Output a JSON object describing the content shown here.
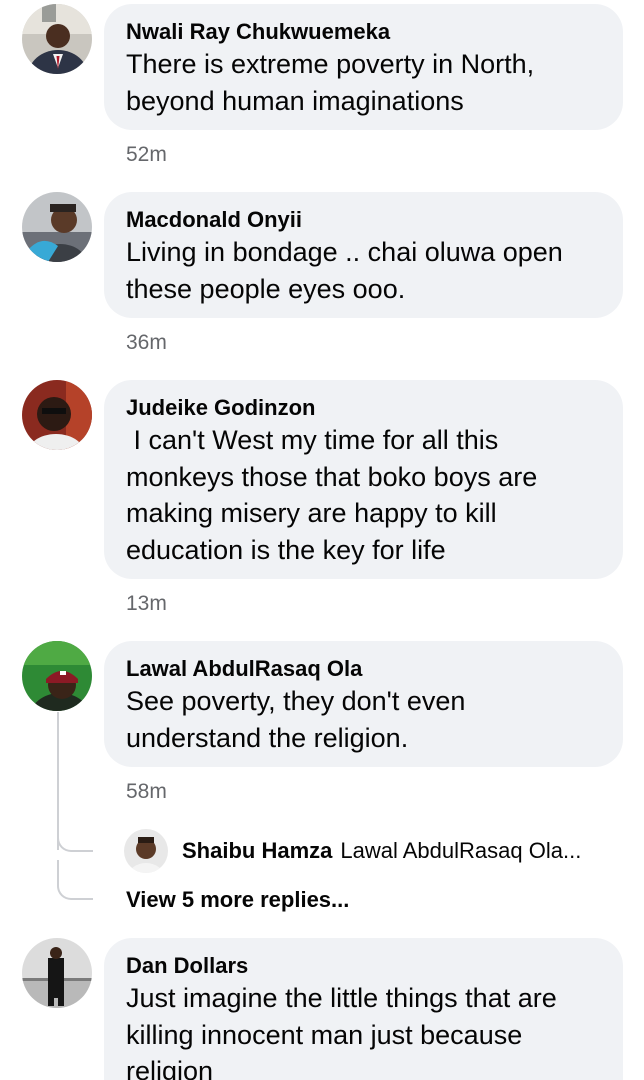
{
  "comments": [
    {
      "author": "Nwali Ray Chukwuemeka",
      "text": "There is extreme poverty in North,\nbeyond human imaginations",
      "time": "52m"
    },
    {
      "author": "Macdonald Onyii",
      "text": "Living in bondage .. chai oluwa open\nthese people eyes ooo.",
      "time": "36m"
    },
    {
      "author": "Judeike Godinzon",
      "text": " I can't West my time for all this\nmonkeys those that boko boys are\nmaking misery are happy to kill\neducation is the key for life",
      "time": "13m"
    },
    {
      "author": "Lawal AbdulRasaq Ola",
      "text": "See poverty, they don't even\nunderstand the religion.",
      "time": "58m",
      "reply_preview": {
        "author": "Shaibu Hamza",
        "text": "Lawal AbdulRasaq Ola..."
      },
      "view_more": "View 5 more replies..."
    },
    {
      "author": "Dan Dollars",
      "text": "Just imagine the little things that are\nkilling innocent man just because\nreligion"
    }
  ],
  "colors": {
    "bubble": "#f0f2f5",
    "time": "#65676b",
    "thread_line": "#ced0d4"
  }
}
